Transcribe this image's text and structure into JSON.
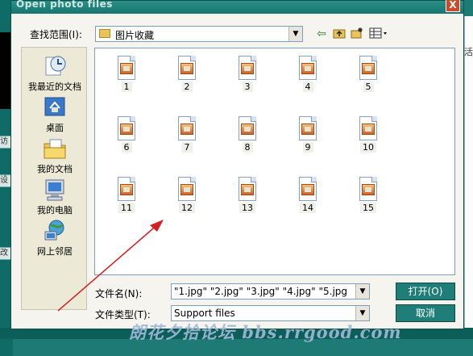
{
  "dialog": {
    "title": "Open photo files",
    "close_glyph": "X",
    "look_in_label": "查找范围(I):",
    "look_in_value": "图片收藏"
  },
  "places": [
    {
      "label": "我最近的文档",
      "icon": "recent-documents-icon"
    },
    {
      "label": "桌面",
      "icon": "desktop-icon"
    },
    {
      "label": "我的文档",
      "icon": "my-documents-icon"
    },
    {
      "label": "我的电脑",
      "icon": "my-computer-icon"
    },
    {
      "label": "网上邻居",
      "icon": "network-places-icon"
    }
  ],
  "files": [
    "1",
    "2",
    "3",
    "4",
    "5",
    "6",
    "7",
    "8",
    "9",
    "10",
    "11",
    "12",
    "13",
    "14",
    "15"
  ],
  "filename_label": "文件名(N):",
  "filename_value": "\"1.jpg\" \"2.jpg\" \"3.jpg\" \"4.jpg\" \"5.jpg",
  "filetype_label": "文件类型(T):",
  "filetype_value": "Support files",
  "open_button": "打开(O)",
  "cancel_button": "取消",
  "background": {
    "left_snippets": [
      "访",
      "设置",
      "改"
    ],
    "right_char": "活"
  },
  "watermark": "朗花夕拾论坛 bbs.rrgood.com"
}
